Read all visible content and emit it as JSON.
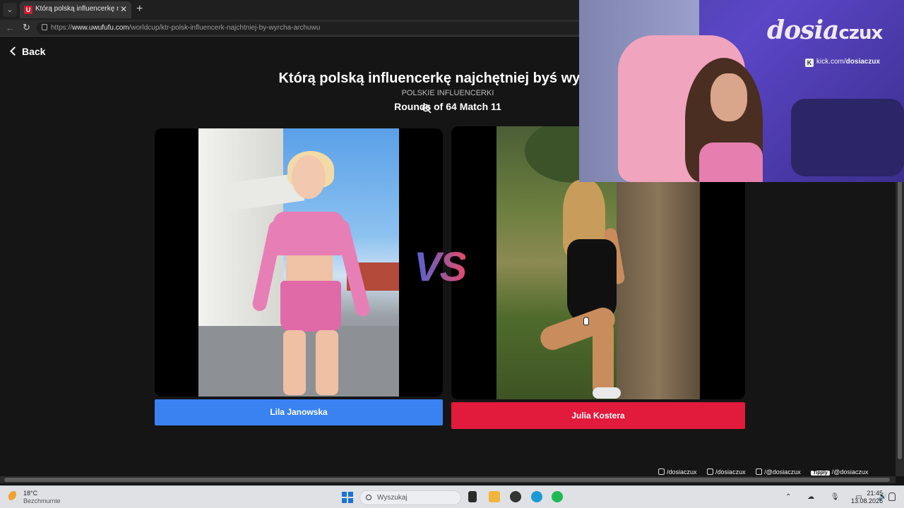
{
  "browser": {
    "tab_title": "Którą polską influencerkę najchętniej być",
    "tab_favicon": "U",
    "tab_close": "✕",
    "new_tab": "+",
    "url_prefix": "https://",
    "url_domain": "www.uwufufu.com",
    "url_path": "/worldcup/ktr-polsk-influencerk-najchtniej-by-wyrcha-archuwu"
  },
  "page": {
    "back_label": "Back",
    "title": "Którą polską influencerkę najchętniej byś wyrwał?",
    "subtitle": "POLSKIE INFLUENCERKI",
    "round": "Rounds of 64 Match 11",
    "vs": "VS",
    "left_choice": "Lila Janowska",
    "right_choice": "Julia Kostera"
  },
  "stream_overlay": {
    "logo_main": "dosia",
    "logo_tail": "czux",
    "kick_prefix": "kick.com/",
    "kick_handle": "dosiaczux",
    "socials": [
      "/dosiaczux",
      "/dosiaczux",
      "/@dosiaczux",
      "/@dosiaczux"
    ],
    "tipply_label": "Tipply"
  },
  "taskbar": {
    "weather_temp": "18°C",
    "weather_desc": "Bezchmurnie",
    "search_placeholder": "Wyszukaj",
    "time": "21:45",
    "date": "13.08.2026",
    "tray_icons": "⌃ ☁ 🎙 ▭ 🔊"
  },
  "colors": {
    "left_button": "#3a82f2",
    "right_button": "#e21a3c",
    "vs_gradient_start": "#4f63d6",
    "vs_gradient_end": "#e24c6a"
  },
  "icons": [
    "tab-menu-icon",
    "favicon-icon",
    "close-icon",
    "plus-icon",
    "back-arrow-icon",
    "reload-icon",
    "lock-icon",
    "chevron-left-icon",
    "zoom-in-icon",
    "instagram-icon",
    "tiktok-icon",
    "youtube-icon",
    "kick-icon",
    "weather-moon-icon",
    "windows-start-icon",
    "search-icon",
    "notification-bell-icon"
  ]
}
